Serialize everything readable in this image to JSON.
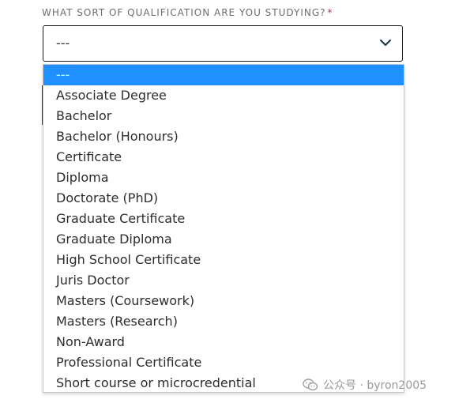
{
  "form": {
    "label": "WHAT SORT OF QUALIFICATION ARE YOU STUDYING?",
    "required_marker": "*",
    "selected_value": "---",
    "chevron_icon": "chevron-down-icon"
  },
  "dropdown": {
    "options": [
      {
        "label": "---",
        "selected": true
      },
      {
        "label": "Associate Degree"
      },
      {
        "label": "Bachelor"
      },
      {
        "label": "Bachelor (Honours)"
      },
      {
        "label": "Certificate"
      },
      {
        "label": "Diploma"
      },
      {
        "label": "Doctorate (PhD)"
      },
      {
        "label": "Graduate Certificate"
      },
      {
        "label": "Graduate Diploma"
      },
      {
        "label": "High School Certificate"
      },
      {
        "label": "Juris Doctor"
      },
      {
        "label": "Masters (Coursework)"
      },
      {
        "label": "Masters (Research)"
      },
      {
        "label": "Non-Award"
      },
      {
        "label": "Professional Certificate"
      },
      {
        "label": "Short course or microcredential"
      }
    ],
    "highlight_color": "#1e90ff"
  },
  "watermark": {
    "text": "公众号 · byron2005",
    "icon": "wechat-icon"
  }
}
